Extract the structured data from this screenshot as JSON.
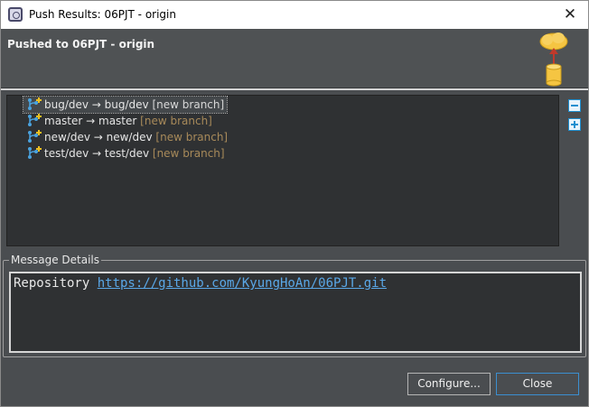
{
  "window": {
    "title": "Push Results: 06PJT - origin",
    "close_glyph": "✕"
  },
  "banner": {
    "title": "Pushed to 06PJT - origin",
    "icon": "push-to-repository-icon"
  },
  "results": {
    "rows": [
      {
        "ref": "bug/dev → bug/dev",
        "status": "[new branch]",
        "icon": "new-branch-icon"
      },
      {
        "ref": "master → master",
        "status": "[new branch]",
        "icon": "new-branch-icon"
      },
      {
        "ref": "new/dev → new/dev",
        "status": "[new branch]",
        "icon": "new-branch-icon"
      },
      {
        "ref": "test/dev → test/dev",
        "status": "[new branch]",
        "icon": "new-branch-icon"
      }
    ],
    "selected_row": 0
  },
  "side_tools": {
    "collapse_icon": "collapse-all-icon",
    "expand_icon": "expand-all-icon"
  },
  "message": {
    "group_label": "Message Details",
    "prefix": "Repository ",
    "link": "https://github.com/KyungHoAn/06PJT.git"
  },
  "buttons": {
    "configure": "Configure...",
    "close": "Close"
  },
  "colors": {
    "accent": "#3b8fd0",
    "new_branch_status": "#a88a5a",
    "link": "#5aa8e8"
  }
}
